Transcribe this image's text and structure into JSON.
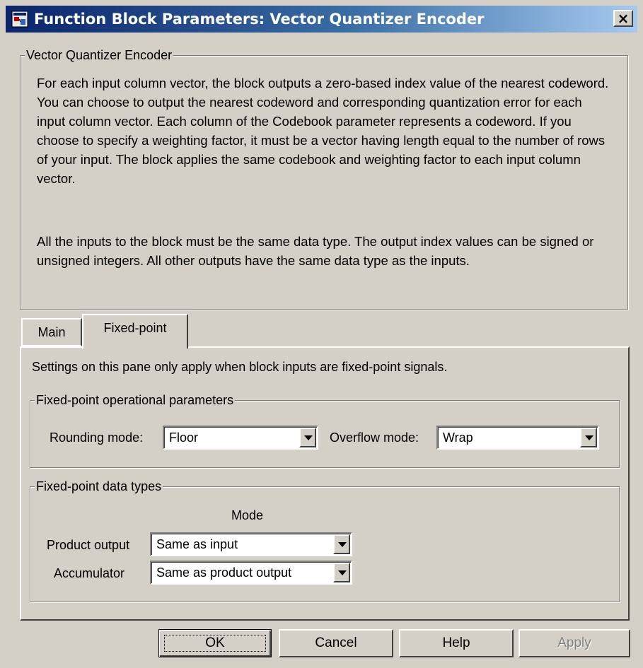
{
  "window": {
    "title": "Function Block Parameters: Vector Quantizer Encoder",
    "close_symbol": "×",
    "icon": "simulink-icon"
  },
  "description": {
    "group_label": "Vector Quantizer Encoder",
    "paragraph1": "For each input column vector, the block outputs a zero-based index value of the nearest codeword. You can choose to output the nearest codeword and corresponding quantization error for each input column vector. Each column of the Codebook parameter represents a codeword. If you choose to specify a weighting factor, it must be a vector having length equal to the number of rows of your input. The block applies the same codebook and weighting factor to each input column vector.",
    "paragraph2": "All the inputs to the block must be the same data type. The output index values can be signed or unsigned integers. All other outputs have the same data type as the inputs."
  },
  "tabs": [
    {
      "label": "Main",
      "active": false
    },
    {
      "label": "Fixed-point",
      "active": true
    }
  ],
  "fixed_point": {
    "note": "Settings on this pane only apply when block inputs are fixed-point signals.",
    "operational": {
      "group_label": "Fixed-point operational parameters",
      "rounding_label": "Rounding mode:",
      "rounding_value": "Floor",
      "overflow_label": "Overflow mode:",
      "overflow_value": "Wrap"
    },
    "data_types": {
      "group_label": "Fixed-point data types",
      "mode_header": "Mode",
      "rows": [
        {
          "label": "Product output",
          "value": "Same as input"
        },
        {
          "label": "Accumulator",
          "value": "Same as product output"
        }
      ]
    }
  },
  "buttons": {
    "ok": "OK",
    "cancel": "Cancel",
    "help": "Help",
    "apply": "Apply"
  }
}
